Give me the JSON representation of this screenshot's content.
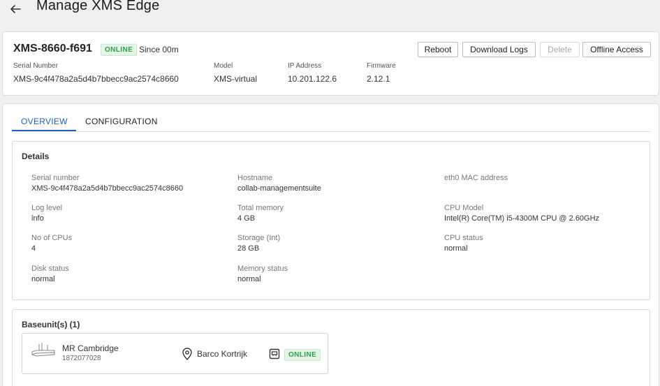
{
  "header": {
    "title": "Manage XMS Edge"
  },
  "device": {
    "name": "XMS-8660-f691",
    "status": "ONLINE",
    "since": "Since 00m",
    "serial_label": "Serial Number",
    "serial_value": "XMS-9c4f478a2a5d4b7bbecc9ac2574c8660",
    "model_label": "Model",
    "model_value": "XMS-virtual",
    "ip_label": "IP Address",
    "ip_value": "10.201.122.6",
    "firmware_label": "Firmware",
    "firmware_value": "2.12.1"
  },
  "actions": {
    "reboot": "Reboot",
    "download_logs": "Download Logs",
    "delete": "Delete",
    "offline_access": "Offline Access"
  },
  "tabs": [
    {
      "label": "OVERVIEW",
      "active": true
    },
    {
      "label": "CONFIGURATION",
      "active": false
    }
  ],
  "details": {
    "title": "Details",
    "fields": [
      {
        "label": "Serial number",
        "value": "XMS-9c4f478a2a5d4b7bbecc9ac2574c8660"
      },
      {
        "label": "Hostname",
        "value": "collab-managementsuite"
      },
      {
        "label": "eth0 MAC address",
        "value": ""
      },
      {
        "label": "Log level",
        "value": "info"
      },
      {
        "label": "Total memory",
        "value": "4 GB"
      },
      {
        "label": "CPU Model",
        "value": "Intel(R) Core(TM) i5-4300M CPU @ 2.60GHz"
      },
      {
        "label": "No of CPUs",
        "value": "4"
      },
      {
        "label": "Storage (Int)",
        "value": "28 GB"
      },
      {
        "label": "CPU status",
        "value": "normal"
      },
      {
        "label": "Disk status",
        "value": "normal"
      },
      {
        "label": "Memory status",
        "value": "normal"
      }
    ]
  },
  "baseunits": {
    "title": "Baseunit(s) (1)",
    "items": [
      {
        "name": "MR Cambridge",
        "id": "1872077028",
        "location": "Barco Kortrijk",
        "status": "ONLINE"
      }
    ]
  },
  "colors": {
    "accent": "#1f5fbf",
    "online_text": "#2e9e4f",
    "online_bg": "#e4f5e7"
  }
}
